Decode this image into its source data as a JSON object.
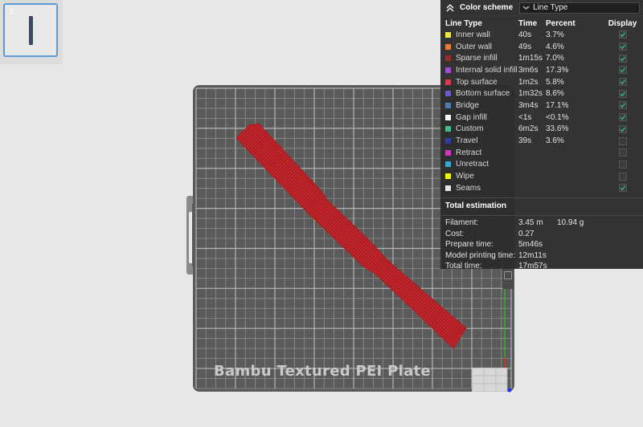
{
  "thumbnail": {
    "index": "1"
  },
  "plate": {
    "label": "Bambu Textured PEI Plate"
  },
  "panel": {
    "header": {
      "title": "Color scheme",
      "select_value": "Line Type"
    },
    "columns": {
      "type": "Line Type",
      "time": "Time",
      "percent": "Percent",
      "display": "Display"
    },
    "rows": [
      {
        "label": "Inner wall",
        "time": "40s",
        "percent": "3.7%",
        "color": "#f2e640",
        "checked": true
      },
      {
        "label": "Outer wall",
        "time": "49s",
        "percent": "4.6%",
        "color": "#f07b28",
        "checked": true
      },
      {
        "label": "Sparse infill",
        "time": "1m15s",
        "percent": "7.0%",
        "color": "#9c2a2a",
        "checked": true
      },
      {
        "label": "Internal solid infill",
        "time": "3m6s",
        "percent": "17.3%",
        "color": "#a24ad8",
        "checked": true
      },
      {
        "label": "Top surface",
        "time": "1m2s",
        "percent": "5.8%",
        "color": "#e0344a",
        "checked": true
      },
      {
        "label": "Bottom surface",
        "time": "1m32s",
        "percent": "8.6%",
        "color": "#6a5acd",
        "checked": true
      },
      {
        "label": "Bridge",
        "time": "3m4s",
        "percent": "17.1%",
        "color": "#4a7cb8",
        "checked": true
      },
      {
        "label": "Gap infill",
        "time": "<1s",
        "percent": "<0.1%",
        "color": "#ffffff",
        "checked": true
      },
      {
        "label": "Custom",
        "time": "6m2s",
        "percent": "33.6%",
        "color": "#3fbf8a",
        "checked": true
      },
      {
        "label": "Travel",
        "time": "39s",
        "percent": "3.6%",
        "color": "#2f3fa8",
        "checked": false
      },
      {
        "label": "Retract",
        "time": "",
        "percent": "",
        "color": "#d632c8",
        "checked": false
      },
      {
        "label": "Unretract",
        "time": "",
        "percent": "",
        "color": "#2fa8d8",
        "checked": false
      },
      {
        "label": "Wipe",
        "time": "",
        "percent": "",
        "color": "#f4f400",
        "checked": false
      },
      {
        "label": "Seams",
        "time": "",
        "percent": "",
        "color": "#e6e6e6",
        "checked": true
      }
    ],
    "total": {
      "title": "Total estimation",
      "filament_label": "Filament:",
      "filament_length": "3.45 m",
      "filament_weight": "10.94 g",
      "cost_label": "Cost:",
      "cost_value": "0.27",
      "prepare_label": "Prepare time:",
      "prepare_value": "5m46s",
      "model_label": "Model printing time:",
      "model_value": "12m11s",
      "total_label": "Total time:",
      "total_value": "17m57s"
    }
  },
  "colors": {
    "plate": "#5a5a5a",
    "model": "#c8262b",
    "panel_bg": "#2c2c2c",
    "check_green": "#2fae6a",
    "accent": "#5b9bd5"
  }
}
